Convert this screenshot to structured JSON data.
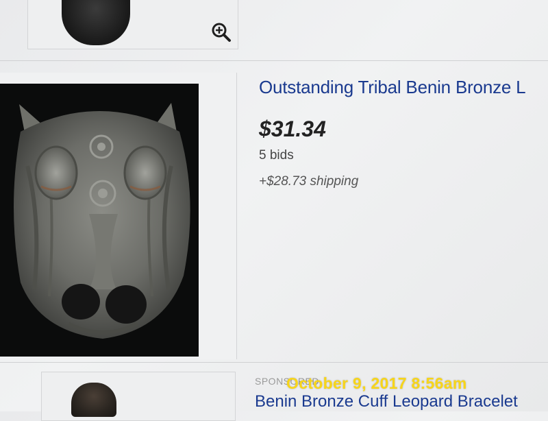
{
  "colors": {
    "link_blue": "#1a3a8f",
    "price_text": "#222222",
    "timestamp_yellow": "#f7d51a"
  },
  "listings": [
    {
      "zoom_icon": "zoom-in-icon"
    },
    {
      "title": "Outstanding Tribal Benin Bronze L",
      "price": "$31.34",
      "bids": "5 bids",
      "shipping": "+$28.73 shipping"
    },
    {
      "sponsored_label": "SPONSORED",
      "title": "Benin Bronze Cuff Leopard Bracelet"
    }
  ],
  "timestamp": "October 9, 2017 8:56am"
}
